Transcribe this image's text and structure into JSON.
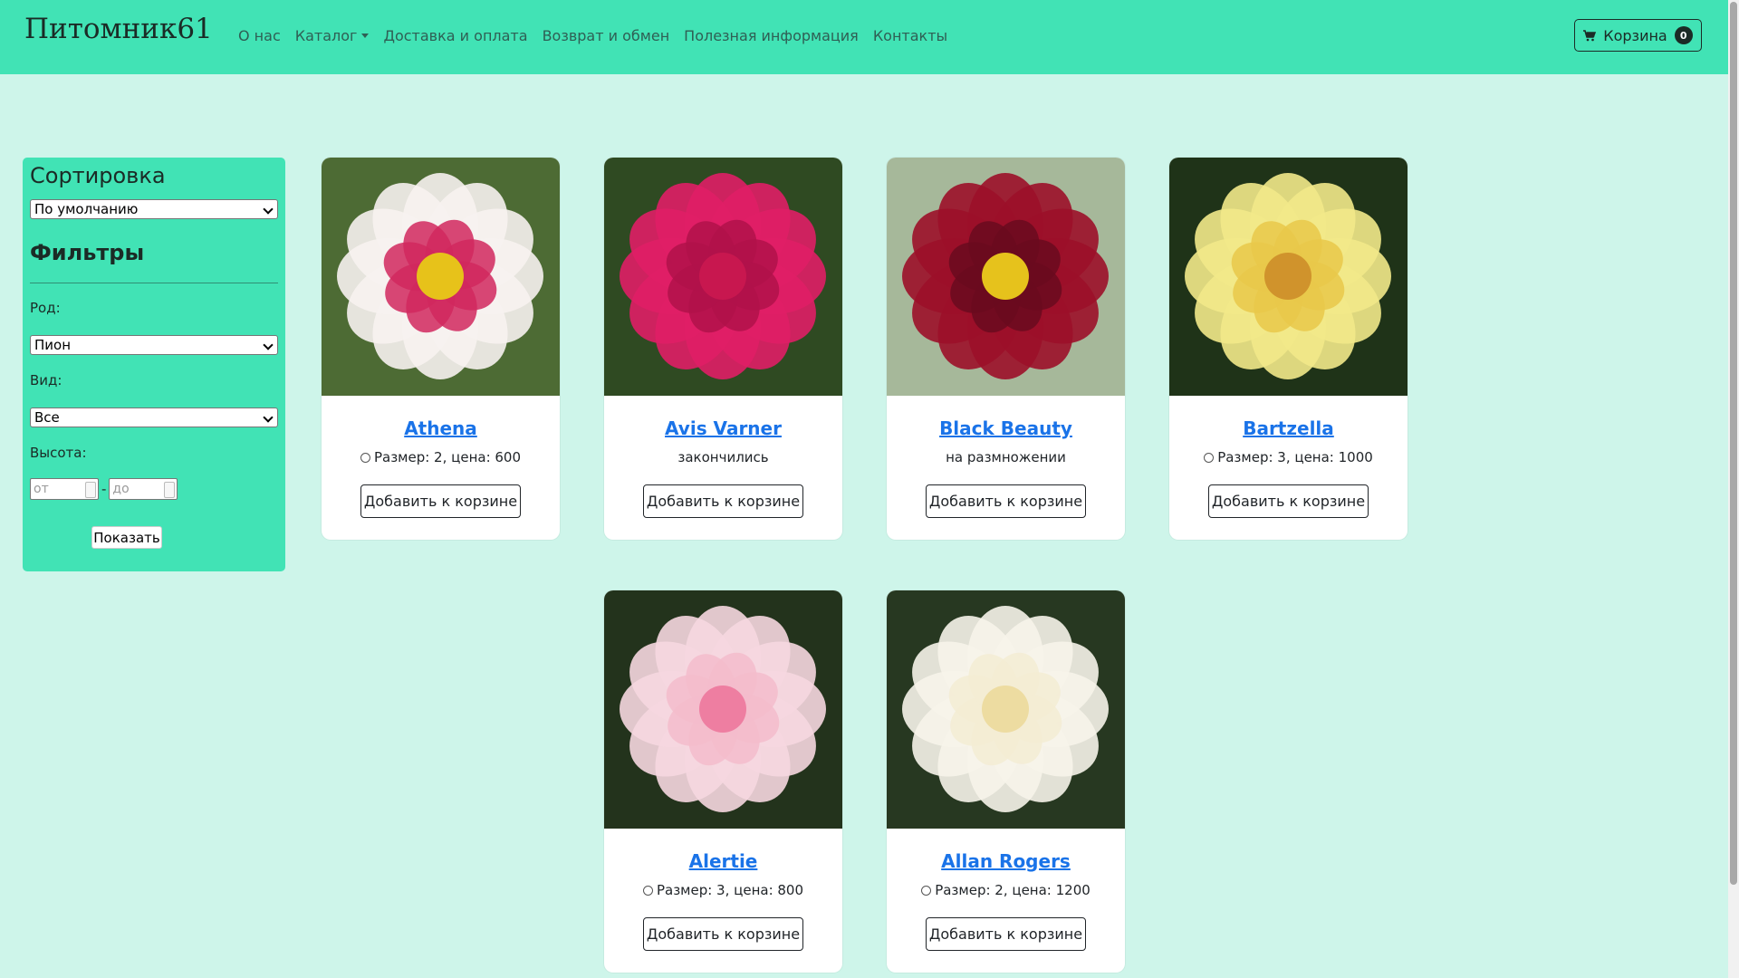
{
  "navbar": {
    "brand": "Питомник61",
    "links": [
      "О нас",
      "Каталог",
      "Доставка и оплата",
      "Возврат и обмен",
      "Полезная информация",
      "Контакты"
    ],
    "cart_label": "Корзина",
    "cart_count": "0"
  },
  "sidebar": {
    "sort_heading": "Сортировка",
    "sort_value": "По умолчанию",
    "filters_heading": "Фильтры",
    "genus_label": "Род:",
    "genus_value": "Пион",
    "species_label": "Вид:",
    "species_value": "Все",
    "height_label": "Высота:",
    "height_from_placeholder": "от",
    "height_to_placeholder": "до",
    "separator": "-",
    "show_button": "Показать"
  },
  "products": [
    {
      "name": "Athena",
      "info": "Размер: 2, цена: 600",
      "has_radio": true,
      "button": "Добавить к корзине",
      "petal": "#f7f2ef",
      "center": "#d1285e",
      "core": "#e7c21a",
      "bg": "#4d6b34"
    },
    {
      "name": "Avis Varner",
      "info": "закончились",
      "has_radio": false,
      "button": "Добавить к корзине",
      "petal": "#e01e66",
      "center": "#b0124a",
      "core": "#c8174f",
      "bg": "#2f4a22"
    },
    {
      "name": "Black Beauty",
      "info": "на размножении",
      "has_radio": false,
      "button": "Добавить к корзине",
      "petal": "#9c1029",
      "center": "#6a0a1e",
      "core": "#e6c21c",
      "bg": "#a6b89a"
    },
    {
      "name": "Bartzella",
      "info": "Размер: 3, цена: 1000",
      "has_radio": true,
      "button": "Добавить к корзине",
      "petal": "#f2e98a",
      "center": "#e9c84a",
      "core": "#d0932c",
      "bg": "#1f3318"
    },
    {
      "name": "Alertie",
      "info": "Размер: 3, цена: 800",
      "has_radio": true,
      "button": "Добавить к корзине",
      "petal": "#f6d7e0",
      "center": "#f3bccb",
      "core": "#ee7ea1",
      "bg": "#23331c"
    },
    {
      "name": "Allan Rogers",
      "info": "Размер: 2, цена: 1200",
      "has_radio": true,
      "button": "Добавить к корзине",
      "petal": "#f7f4ea",
      "center": "#f3ecd4",
      "core": "#eddca1",
      "bg": "#273821"
    }
  ]
}
